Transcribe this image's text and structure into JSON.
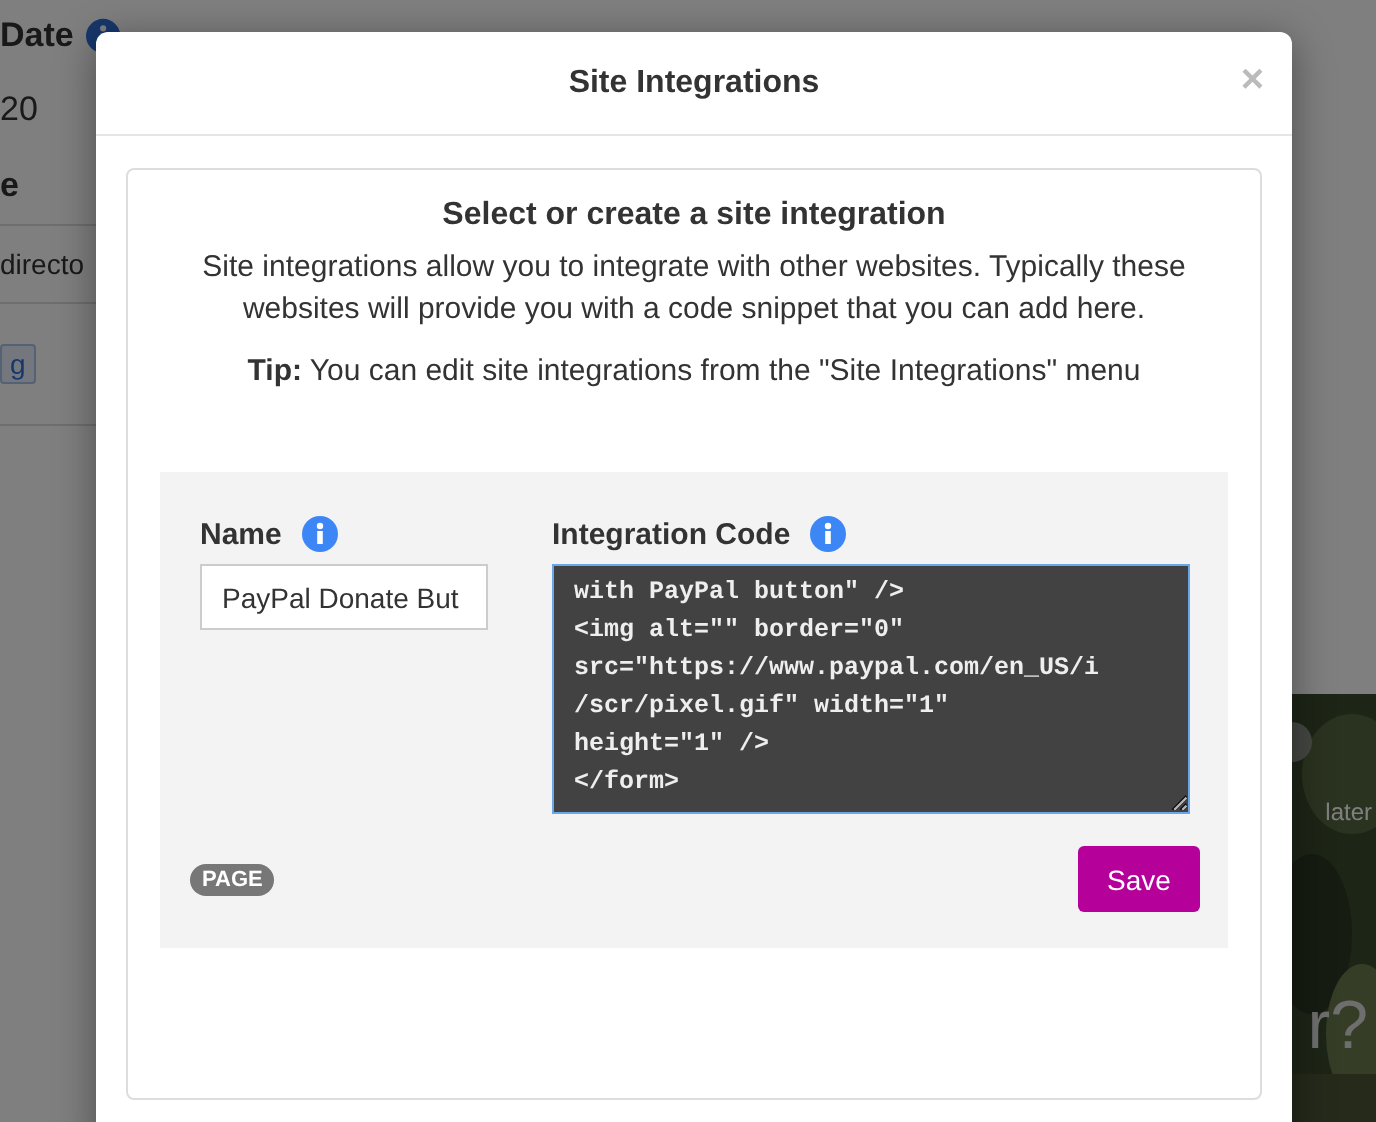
{
  "background_page": {
    "date_label": "Date",
    "date_value": "20",
    "column_label": "e",
    "row_text": "directo",
    "tag": "g",
    "picture_caption": "later",
    "picture_text": "r?"
  },
  "modal": {
    "title": "Site Integrations",
    "close": "×",
    "heading": "Select or create a site integration",
    "description": "Site integrations allow you to integrate with other websites. Typically these websites will provide you with a code snippet that you can add here.",
    "tip": "**Tip:** You can edit site integrations from the \"Site Integrations\" menu",
    "form": {
      "name_label": "Name",
      "name_value": "PayPal Donate But",
      "code_label": "Integration Code",
      "code_value": "with PayPal button\" />\n<img alt=\"\" border=\"0\"\nsrc=\"https://www.paypal.com/en_US/i\n/scr/pixel.gif\" width=\"1\"\nheight=\"1\" />\n</form>",
      "badge": "PAGE",
      "save": "Save"
    }
  }
}
